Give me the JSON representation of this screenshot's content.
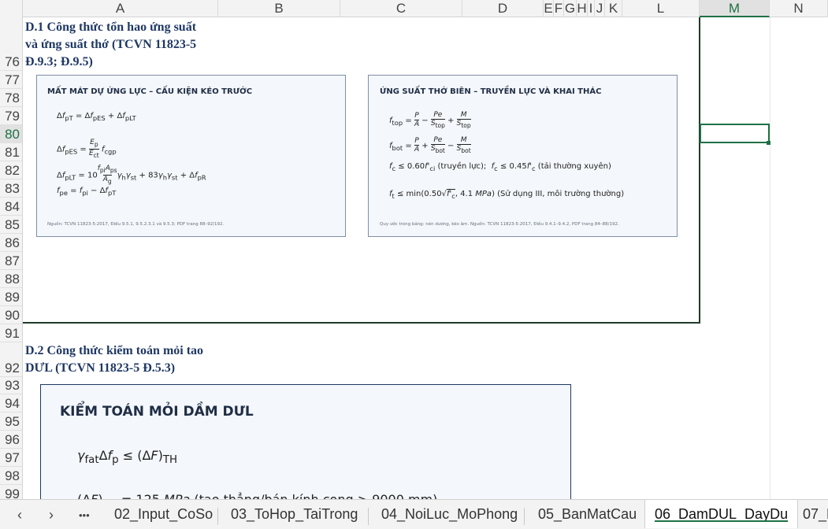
{
  "columns": [
    "A",
    "B",
    "C",
    "D",
    "E",
    "F",
    "G",
    "H",
    "I",
    "J",
    "K",
    "L",
    "M",
    "N"
  ],
  "selected_column": "M",
  "rows": [
    "76",
    "77",
    "78",
    "79",
    "80",
    "81",
    "82",
    "83",
    "84",
    "85",
    "86",
    "87",
    "88",
    "89",
    "90",
    "91",
    "92",
    "93",
    "94",
    "95",
    "96",
    "97",
    "98",
    "99"
  ],
  "selected_row": "80",
  "section1": {
    "title_line1": "D.1 Công thức tổn hao ứng suất",
    "title_line2": "và ứng suất thớ (TCVN 11823-5",
    "title_line3": "Đ.9.3; Đ.9.5)"
  },
  "panel_left": {
    "title": "MẤT MÁT DỰ ỨNG LỰC – CẤU KIỆN KÉO TRƯỚC",
    "f1": "Δf_pT = Δf_pES + Δf_pLT",
    "f2": "Δf_pES = (E_p / E_ct) f_cgp",
    "f3": "Δf_pLT = 10 (f_pi A_ps / A_g) γh γst + 83 γh γst + Δf_pR",
    "f4": "f_pe = f_pi − Δf_pT",
    "note": "Nguồn: TCVN 11823-5:2017, Điều 9.5.1, 9.5.2.3.1 và 9.5.3; PDF trang 88–92/192."
  },
  "panel_right": {
    "title": "ỨNG SUẤT THỚ BIÊN – TRUYỀN LỰC VÀ KHAI THÁC",
    "f1": "f_top = P/A − Pe/S_top + M/S_top",
    "f2": "f_bot = P/A + Pe/S_bot − M/S_bot",
    "f3": "f_c ≤ 0.60f'_ci (truyền lực);  f_c ≤ 0.45f'_c (tải thường xuyên)",
    "f4": "f_t ≤ min(0.50√f'_c , 4.1 MPa) (Sử dụng III, môi trường thường)",
    "note": "Quy ước trong bảng: nén dương, kéo âm. Nguồn: TCVN 11823-5:2017, Điều 9.4.1–9.4.2, PDF trang 84–88/192."
  },
  "section2": {
    "title_line1": "D.2 Công thức kiểm toán mỏi tao",
    "title_line2": "DƯL (TCVN 11823-5 Đ.5.3)"
  },
  "fatigue_panel": {
    "title": "KIỂM TOÁN MỎI DẦM DƯL",
    "f1": "γfat Δf_p ≤ (ΔF)_TH",
    "f2": "(ΔF)_TH = 125 MPa (tao thẳng/bán kính cong > 9000 mm)"
  },
  "tabs": [
    "02_Input_CoSo",
    "03_ToHop_TaiTrong",
    "04_NoiLuc_MoPhong",
    "05_BanMatCau",
    "06_DamDUL_DayDu",
    "07_L"
  ],
  "active_tab": "06_DamDUL_DayDu",
  "nav": {
    "prev": "‹",
    "next": "›",
    "more": "•••"
  },
  "colors": {
    "accent": "#1e7145",
    "title_blue": "#1f3864",
    "panel_bg": "#f4f7fb"
  }
}
